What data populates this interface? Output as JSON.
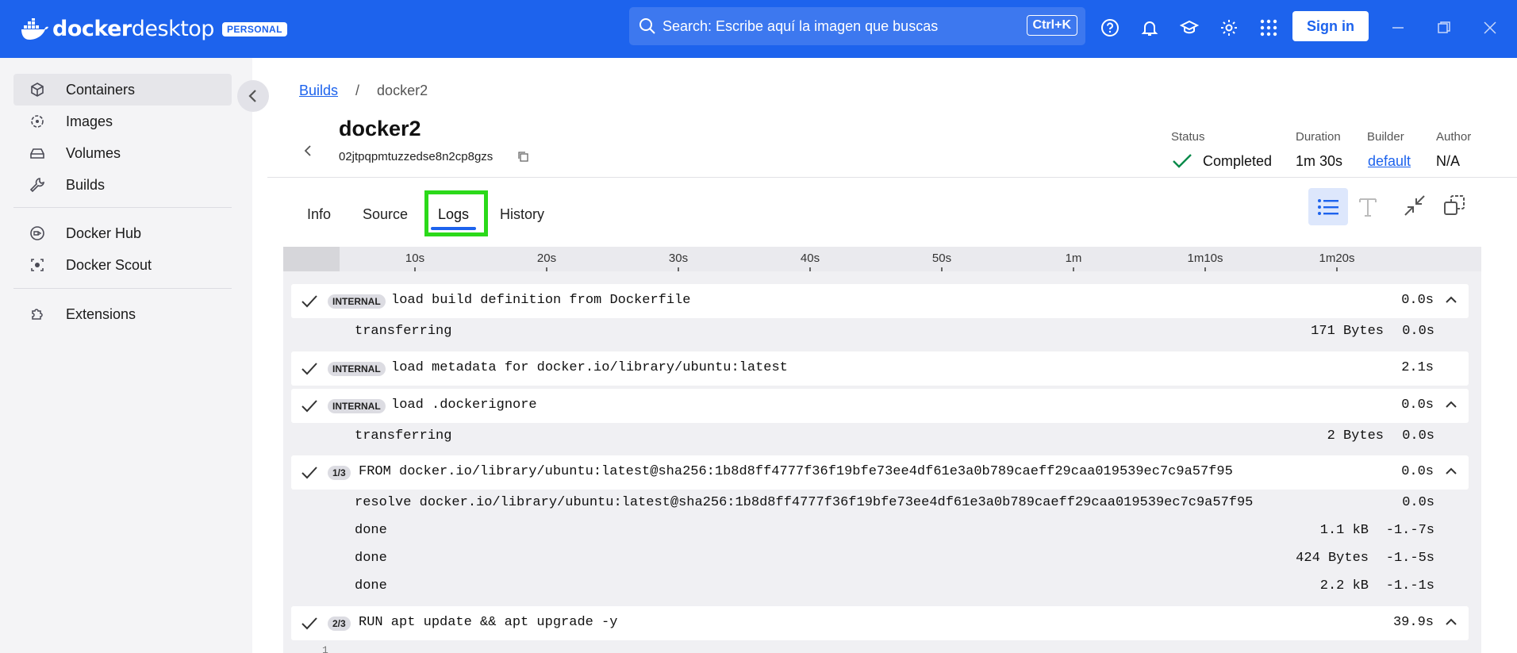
{
  "app": {
    "brand_name": "docker desktop",
    "brand_bold": "docker",
    "brand_light": "desktop",
    "plan_badge": "PERSONAL",
    "search_placeholder": "Search: Escribe aquí la imagen que buscas",
    "search_shortcut": "Ctrl+K",
    "sign_in_label": "Sign in",
    "accent_color": "#1d63ed"
  },
  "sidebar": {
    "items": [
      {
        "label": "Containers",
        "icon": "cube-icon",
        "active": true
      },
      {
        "label": "Images",
        "icon": "layers-icon"
      },
      {
        "label": "Volumes",
        "icon": "drive-icon"
      },
      {
        "label": "Builds",
        "icon": "wrench-icon"
      },
      {
        "label": "Docker Hub",
        "icon": "hub-icon"
      },
      {
        "label": "Docker Scout",
        "icon": "scout-icon"
      },
      {
        "label": "Extensions",
        "icon": "puzzle-icon"
      }
    ]
  },
  "breadcrumb": {
    "parent": "Builds",
    "separator": "/",
    "current": "docker2"
  },
  "build": {
    "name": "docker2",
    "id": "02jtpqpmtuzzedse8n2cp8gzs",
    "status_label": "Status",
    "status": "Completed",
    "duration_label": "Duration",
    "duration": "1m 30s",
    "builder_label": "Builder",
    "builder": "default",
    "author_label": "Author",
    "author": "N/A"
  },
  "tabs": [
    {
      "label": "Info"
    },
    {
      "label": "Source"
    },
    {
      "label": "Logs",
      "active": true
    },
    {
      "label": "History"
    }
  ],
  "timeline": {
    "ticks": [
      "10s",
      "20s",
      "30s",
      "40s",
      "50s",
      "1m",
      "1m10s",
      "1m20s"
    ]
  },
  "steps": [
    {
      "tag": "INTERNAL",
      "command": "load build definition from Dockerfile",
      "duration": "0.0s",
      "expanded": true,
      "details": [
        {
          "text": "transferring",
          "size": "171 Bytes",
          "duration": "0.0s"
        }
      ]
    },
    {
      "tag": "INTERNAL",
      "command": "load metadata for docker.io/library/ubuntu:latest",
      "duration": "2.1s",
      "expanded": false,
      "details": []
    },
    {
      "tag": "INTERNAL",
      "command": "load .dockerignore",
      "duration": "0.0s",
      "expanded": true,
      "details": [
        {
          "text": "transferring",
          "size": "2 Bytes",
          "duration": "0.0s"
        }
      ]
    },
    {
      "tag": "1/3",
      "command": "FROM docker.io/library/ubuntu:latest@sha256:1b8d8ff4777f36f19bfe73ee4df61e3a0b789caeff29caa019539ec7c9a57f95",
      "duration": "0.0s",
      "expanded": true,
      "details": [
        {
          "text": "resolve docker.io/library/ubuntu:latest@sha256:1b8d8ff4777f36f19bfe73ee4df61e3a0b789caeff29caa019539ec7c9a57f95",
          "size": "",
          "duration": "0.0s"
        },
        {
          "text": "done",
          "size": "1.1 kB",
          "duration": "-1.-7s"
        },
        {
          "text": "done",
          "size": "424 Bytes",
          "duration": "-1.-5s"
        },
        {
          "text": "done",
          "size": "2.2 kB",
          "duration": "-1.-1s"
        }
      ]
    },
    {
      "tag": "2/3",
      "command": "RUN apt update && apt upgrade -y",
      "duration": "39.9s",
      "expanded": true,
      "details": []
    }
  ],
  "log_first_line_number": "1"
}
